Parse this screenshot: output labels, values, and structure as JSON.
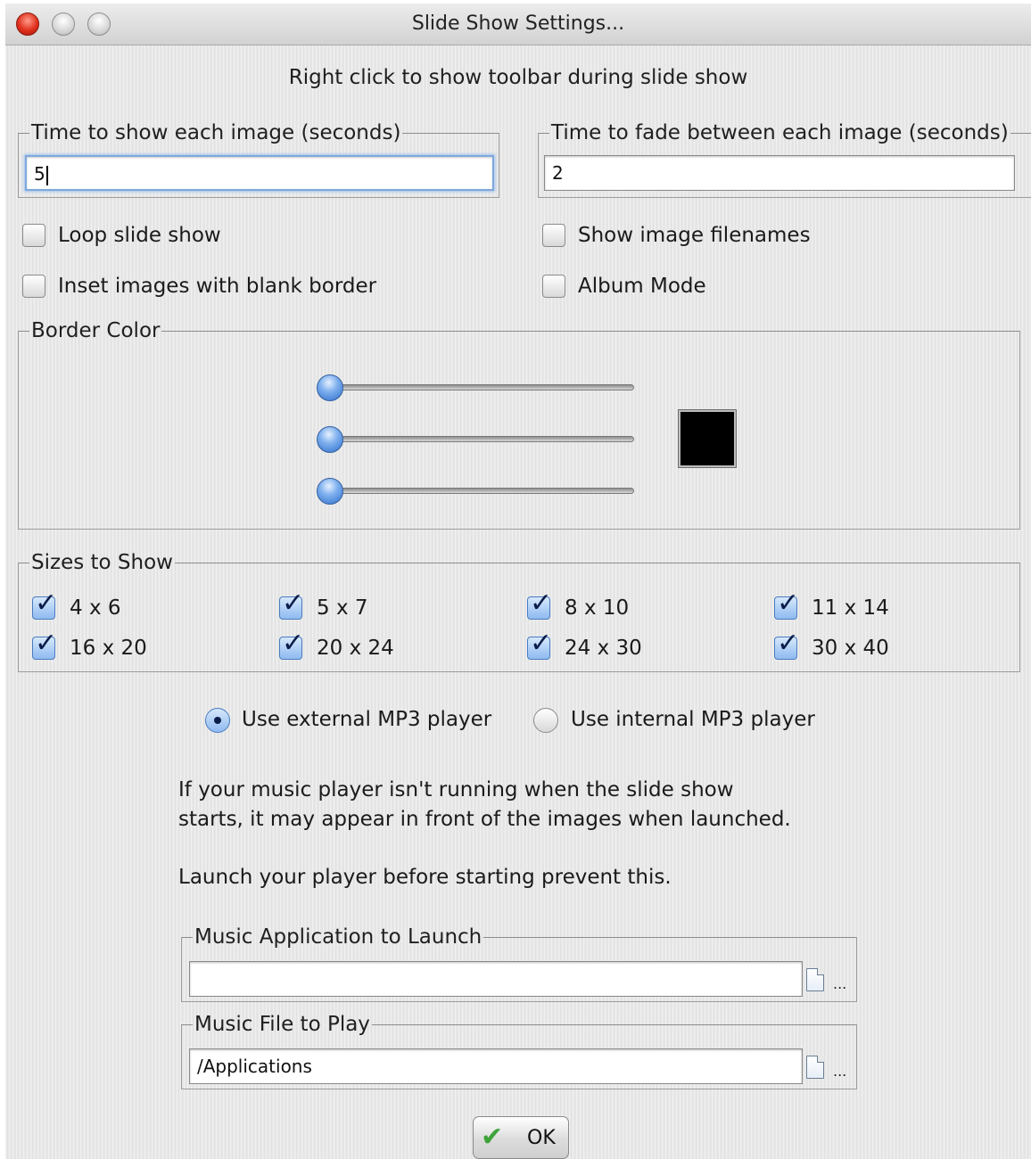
{
  "window": {
    "title": "Slide Show Settings..."
  },
  "hint": "Right click to show toolbar during slide show",
  "timing": {
    "show_label": "Time to show each image (seconds)",
    "show_value": "5",
    "fade_label": "Time to fade between each image (seconds)",
    "fade_value": "2"
  },
  "options": {
    "loop": {
      "label": "Loop slide show",
      "checked": false
    },
    "filenames": {
      "label": "Show image filenames",
      "checked": false
    },
    "inset": {
      "label": "Inset images with blank border",
      "checked": false
    },
    "album": {
      "label": "Album Mode",
      "checked": false
    }
  },
  "border_color": {
    "label": "Border Color",
    "sliders": [
      0,
      0,
      0
    ],
    "swatch_color": "#000000"
  },
  "sizes": {
    "label": "Sizes to Show",
    "items": [
      {
        "label": "4 x 6",
        "checked": true
      },
      {
        "label": "5 x 7",
        "checked": true
      },
      {
        "label": "8 x 10",
        "checked": true
      },
      {
        "label": "11 x 14",
        "checked": true
      },
      {
        "label": "16 x 20",
        "checked": true
      },
      {
        "label": "20 x 24",
        "checked": true
      },
      {
        "label": "24 x 30",
        "checked": true
      },
      {
        "label": "30 x 40",
        "checked": true
      }
    ]
  },
  "player": {
    "external_label": "Use external MP3 player",
    "internal_label": "Use internal MP3 player",
    "selected": "external"
  },
  "info": {
    "line1": "If your music player isn't running when the slide show",
    "line2": "starts, it may appear in front of the images when launched.",
    "line3": "Launch your player before starting prevent this."
  },
  "music_app": {
    "label": "Music Application to Launch",
    "value": "",
    "browse": "..."
  },
  "music_file": {
    "label": "Music File to Play",
    "value": "/Applications",
    "browse": "..."
  },
  "ok_button": {
    "label": "OK"
  }
}
